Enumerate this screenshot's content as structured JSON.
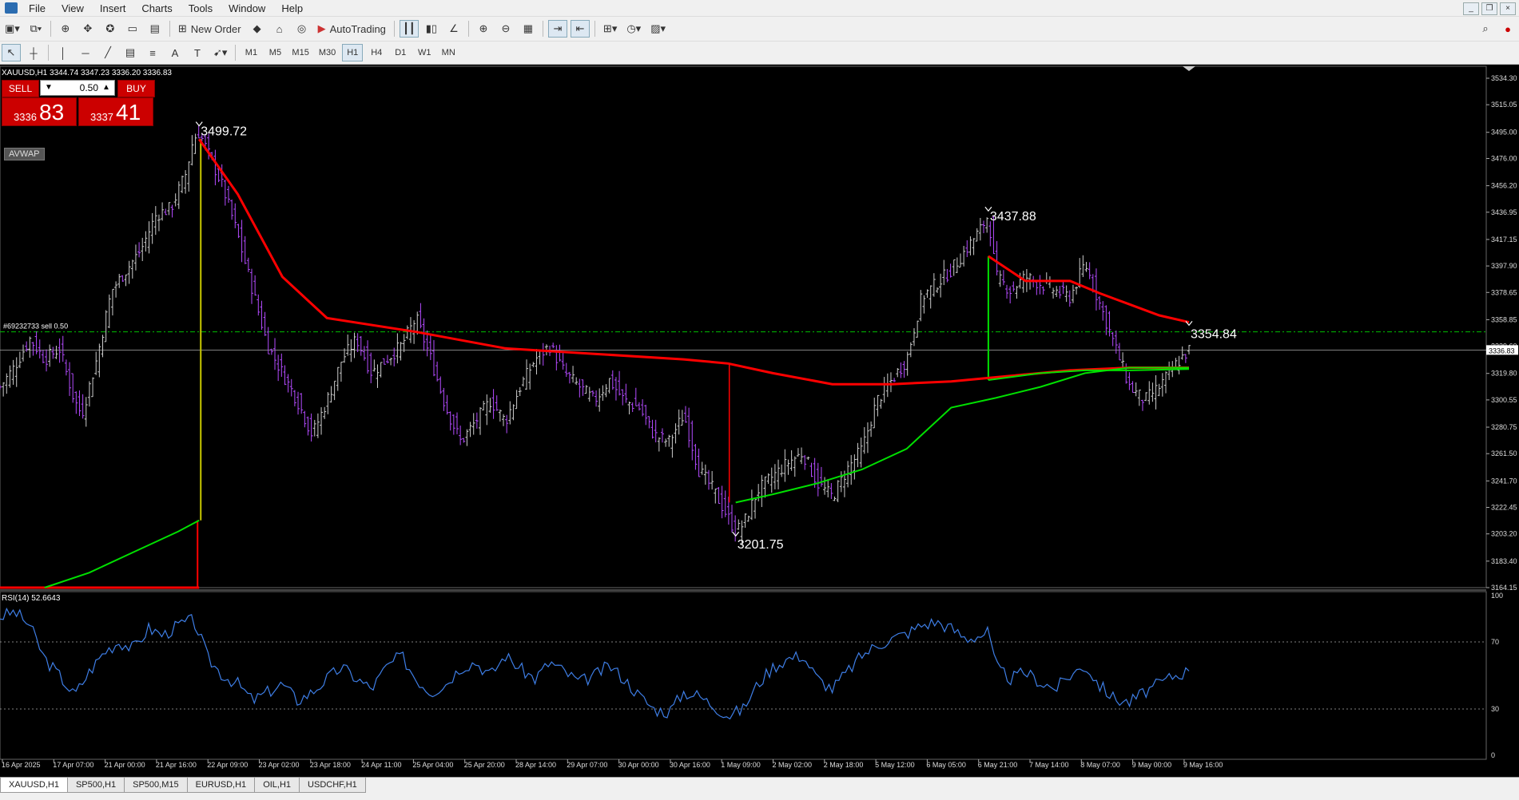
{
  "menu": [
    "File",
    "View",
    "Insert",
    "Charts",
    "Tools",
    "Window",
    "Help"
  ],
  "toolbar": {
    "new_order": "New Order",
    "autotrading": "AutoTrading",
    "timeframes": [
      "M1",
      "M5",
      "M15",
      "M30",
      "H1",
      "H4",
      "D1",
      "W1",
      "MN"
    ],
    "active_timeframe": "H1"
  },
  "trade_panel": {
    "sell_label": "SELL",
    "buy_label": "BUY",
    "lot": "0.50",
    "bid_small": "3336",
    "bid_big": "83",
    "ask_small": "3337",
    "ask_big": "41"
  },
  "indicator_label": "AVWAP",
  "chart_data": [
    {
      "type": "candlestick",
      "header": "XAUUSD,H1  3344.74 3347.23 3336.20 3336.83",
      "symbol": "XAUUSD",
      "timeframe": "H1",
      "ohlc_last": {
        "open": 3344.74,
        "high": 3347.23,
        "low": 3336.2,
        "close": 3336.83
      },
      "ylim": [
        3164.15,
        3543.0
      ],
      "price_ticks": [
        3534.3,
        3515.05,
        3495.0,
        3476.0,
        3456.2,
        3436.95,
        3417.15,
        3397.9,
        3378.65,
        3358.85,
        3339.6,
        3319.8,
        3300.55,
        3280.75,
        3261.5,
        3241.7,
        3222.45,
        3203.2,
        3183.4,
        3164.15
      ],
      "current_price": 3336.83,
      "current_price_label": "3336.83",
      "green_dashdot_level": 3350.0,
      "stray_label": "#69232733 sell 0.50",
      "annotations": [
        {
          "label": "3499.72",
          "price": 3499.72,
          "t": 0.134
        },
        {
          "label": "3437.88",
          "price": 3437.88,
          "t": 0.665
        },
        {
          "label": "3201.75",
          "price": 3201.75,
          "t": 0.495
        },
        {
          "label": "3354.84",
          "price": 3354.84,
          "t": 0.8
        }
      ],
      "time_labels": [
        "16 Apr 2025",
        "17 Apr 07:00",
        "21 Apr 00:00",
        "21 Apr 16:00",
        "22 Apr 09:00",
        "23 Apr 02:00",
        "23 Apr 18:00",
        "24 Apr 11:00",
        "25 Apr 04:00",
        "25 Apr 20:00",
        "28 Apr 14:00",
        "29 Apr 07:00",
        "30 Apr 00:00",
        "30 Apr 16:00",
        "1 May 09:00",
        "2 May 02:00",
        "2 May 18:00",
        "5 May 12:00",
        "6 May 05:00",
        "6 May 21:00",
        "7 May 14:00",
        "8 May 07:00",
        "9 May 00:00",
        "9 May 16:00"
      ],
      "close_path": [
        [
          0,
          3310
        ],
        [
          0.01,
          3325
        ],
        [
          0.02,
          3345
        ],
        [
          0.03,
          3330
        ],
        [
          0.04,
          3338
        ],
        [
          0.05,
          3300
        ],
        [
          0.055,
          3290
        ],
        [
          0.065,
          3330
        ],
        [
          0.075,
          3380
        ],
        [
          0.085,
          3395
        ],
        [
          0.095,
          3410
        ],
        [
          0.105,
          3435
        ],
        [
          0.115,
          3440
        ],
        [
          0.125,
          3465
        ],
        [
          0.13,
          3490
        ],
        [
          0.134,
          3495
        ],
        [
          0.14,
          3480
        ],
        [
          0.15,
          3455
        ],
        [
          0.16,
          3420
        ],
        [
          0.17,
          3380
        ],
        [
          0.18,
          3340
        ],
        [
          0.19,
          3320
        ],
        [
          0.2,
          3300
        ],
        [
          0.21,
          3275
        ],
        [
          0.22,
          3300
        ],
        [
          0.23,
          3330
        ],
        [
          0.24,
          3345
        ],
        [
          0.25,
          3320
        ],
        [
          0.26,
          3330
        ],
        [
          0.27,
          3340
        ],
        [
          0.28,
          3360
        ],
        [
          0.29,
          3330
        ],
        [
          0.3,
          3295
        ],
        [
          0.31,
          3270
        ],
        [
          0.32,
          3285
        ],
        [
          0.33,
          3300
        ],
        [
          0.34,
          3285
        ],
        [
          0.35,
          3310
        ],
        [
          0.36,
          3330
        ],
        [
          0.37,
          3340
        ],
        [
          0.38,
          3320
        ],
        [
          0.39,
          3310
        ],
        [
          0.4,
          3300
        ],
        [
          0.41,
          3315
        ],
        [
          0.42,
          3300
        ],
        [
          0.43,
          3295
        ],
        [
          0.44,
          3275
        ],
        [
          0.45,
          3270
        ],
        [
          0.46,
          3290
        ],
        [
          0.47,
          3250
        ],
        [
          0.48,
          3235
        ],
        [
          0.49,
          3215
        ],
        [
          0.495,
          3205
        ],
        [
          0.5,
          3210
        ],
        [
          0.51,
          3235
        ],
        [
          0.52,
          3245
        ],
        [
          0.53,
          3255
        ],
        [
          0.54,
          3262
        ],
        [
          0.55,
          3240
        ],
        [
          0.56,
          3230
        ],
        [
          0.57,
          3250
        ],
        [
          0.58,
          3265
        ],
        [
          0.59,
          3300
        ],
        [
          0.6,
          3315
        ],
        [
          0.61,
          3330
        ],
        [
          0.62,
          3375
        ],
        [
          0.63,
          3385
        ],
        [
          0.64,
          3395
        ],
        [
          0.65,
          3410
        ],
        [
          0.66,
          3425
        ],
        [
          0.665,
          3435
        ],
        [
          0.67,
          3390
        ],
        [
          0.68,
          3380
        ],
        [
          0.69,
          3390
        ],
        [
          0.7,
          3385
        ],
        [
          0.71,
          3380
        ],
        [
          0.72,
          3375
        ],
        [
          0.73,
          3400
        ],
        [
          0.74,
          3370
        ],
        [
          0.75,
          3340
        ],
        [
          0.76,
          3310
        ],
        [
          0.77,
          3300
        ],
        [
          0.78,
          3310
        ],
        [
          0.79,
          3325
        ],
        [
          0.8,
          3336.83
        ]
      ],
      "avwap_lines": [
        {
          "name": "",
          "color": "#ff0000",
          "points": [
            [
              0.134,
              3490
            ],
            [
              0.16,
              3450
            ],
            [
              0.19,
              3390
            ],
            [
              0.22,
              3360
            ],
            [
              0.28,
              3350
            ],
            [
              0.34,
              3338
            ],
            [
              0.4,
              3334
            ],
            [
              0.46,
              3330
            ],
            [
              0.49,
              3327
            ],
            [
              0.52,
              3320
            ],
            [
              0.56,
              3312
            ],
            [
              0.6,
              3312
            ],
            [
              0.64,
              3314
            ],
            [
              0.68,
              3318
            ],
            [
              0.72,
              3322
            ],
            [
              0.76,
              3324
            ],
            [
              0.8,
              3324
            ]
          ]
        },
        {
          "name": "",
          "color": "#ff0000",
          "points": [
            [
              0.665,
              3405
            ],
            [
              0.69,
              3387
            ],
            [
              0.72,
              3387
            ],
            [
              0.74,
              3378
            ],
            [
              0.76,
              3370
            ],
            [
              0.78,
              3362
            ],
            [
              0.8,
              3357
            ]
          ]
        },
        {
          "name": "",
          "color": "#00e000",
          "points": [
            [
              0.03,
              3164.15
            ],
            [
              0.06,
              3175
            ],
            [
              0.09,
              3190
            ],
            [
              0.12,
              3205
            ],
            [
              0.134,
              3213
            ]
          ]
        },
        {
          "name": "",
          "color": "#00e000",
          "points": [
            [
              0.495,
              3226
            ],
            [
              0.52,
              3232
            ],
            [
              0.55,
              3240
            ],
            [
              0.58,
              3250
            ],
            [
              0.61,
              3265
            ],
            [
              0.64,
              3295
            ],
            [
              0.67,
              3302
            ],
            [
              0.7,
              3310
            ],
            [
              0.73,
              3320
            ],
            [
              0.76,
              3324
            ],
            [
              0.8,
              3324
            ]
          ]
        },
        {
          "name": "",
          "color": "#00e000",
          "points": [
            [
              0.665,
              3315
            ],
            [
              0.7,
              3320
            ],
            [
              0.73,
              3322
            ],
            [
              0.76,
              3322
            ],
            [
              0.8,
              3323
            ]
          ]
        }
      ]
    },
    {
      "type": "line",
      "header": "RSI(14) 52.6643",
      "name": "RSI(14)",
      "current_value": 52.6643,
      "ylim": [
        0,
        100
      ],
      "levels": [
        70,
        30
      ],
      "tick_labels": [
        "100",
        "70",
        "30",
        "0"
      ],
      "values": [
        [
          0,
          85
        ],
        [
          0.01,
          88
        ],
        [
          0.02,
          80
        ],
        [
          0.03,
          60
        ],
        [
          0.04,
          50
        ],
        [
          0.05,
          38
        ],
        [
          0.06,
          52
        ],
        [
          0.07,
          64
        ],
        [
          0.08,
          70
        ],
        [
          0.09,
          66
        ],
        [
          0.1,
          78
        ],
        [
          0.11,
          74
        ],
        [
          0.12,
          80
        ],
        [
          0.13,
          83
        ],
        [
          0.134,
          75
        ],
        [
          0.14,
          60
        ],
        [
          0.15,
          50
        ],
        [
          0.16,
          45
        ],
        [
          0.17,
          35
        ],
        [
          0.18,
          40
        ],
        [
          0.19,
          45
        ],
        [
          0.2,
          35
        ],
        [
          0.21,
          40
        ],
        [
          0.22,
          48
        ],
        [
          0.23,
          55
        ],
        [
          0.24,
          48
        ],
        [
          0.25,
          42
        ],
        [
          0.26,
          55
        ],
        [
          0.27,
          62
        ],
        [
          0.28,
          48
        ],
        [
          0.29,
          40
        ],
        [
          0.3,
          45
        ],
        [
          0.31,
          55
        ],
        [
          0.32,
          58
        ],
        [
          0.33,
          50
        ],
        [
          0.34,
          62
        ],
        [
          0.35,
          54
        ],
        [
          0.36,
          48
        ],
        [
          0.37,
          58
        ],
        [
          0.38,
          52
        ],
        [
          0.39,
          46
        ],
        [
          0.4,
          50
        ],
        [
          0.41,
          56
        ],
        [
          0.42,
          48
        ],
        [
          0.43,
          38
        ],
        [
          0.44,
          30
        ],
        [
          0.45,
          28
        ],
        [
          0.46,
          40
        ],
        [
          0.47,
          38
        ],
        [
          0.48,
          32
        ],
        [
          0.49,
          26
        ],
        [
          0.5,
          30
        ],
        [
          0.51,
          45
        ],
        [
          0.52,
          55
        ],
        [
          0.53,
          60
        ],
        [
          0.54,
          62
        ],
        [
          0.55,
          48
        ],
        [
          0.56,
          42
        ],
        [
          0.57,
          52
        ],
        [
          0.58,
          62
        ],
        [
          0.59,
          68
        ],
        [
          0.6,
          72
        ],
        [
          0.61,
          75
        ],
        [
          0.62,
          80
        ],
        [
          0.63,
          82
        ],
        [
          0.64,
          78
        ],
        [
          0.65,
          72
        ],
        [
          0.66,
          74
        ],
        [
          0.665,
          76
        ],
        [
          0.67,
          55
        ],
        [
          0.68,
          48
        ],
        [
          0.69,
          52
        ],
        [
          0.7,
          46
        ],
        [
          0.71,
          42
        ],
        [
          0.72,
          50
        ],
        [
          0.73,
          56
        ],
        [
          0.74,
          44
        ],
        [
          0.75,
          36
        ],
        [
          0.76,
          34
        ],
        [
          0.77,
          40
        ],
        [
          0.78,
          45
        ],
        [
          0.79,
          50
        ],
        [
          0.8,
          52.66
        ]
      ]
    }
  ],
  "tabs": [
    "XAUUSD,H1",
    "SP500,H1",
    "SP500,M15",
    "EURUSD,H1",
    "OIL,H1",
    "USDCHF,H1"
  ],
  "active_tab": "XAUUSD,H1",
  "colors": {
    "bull": "#cccccc",
    "bear": "#b44bff",
    "avwap_red": "#ff0000",
    "avwap_green": "#00e000",
    "rsi": "#3e7ee6",
    "grid_level": "#00c000"
  }
}
